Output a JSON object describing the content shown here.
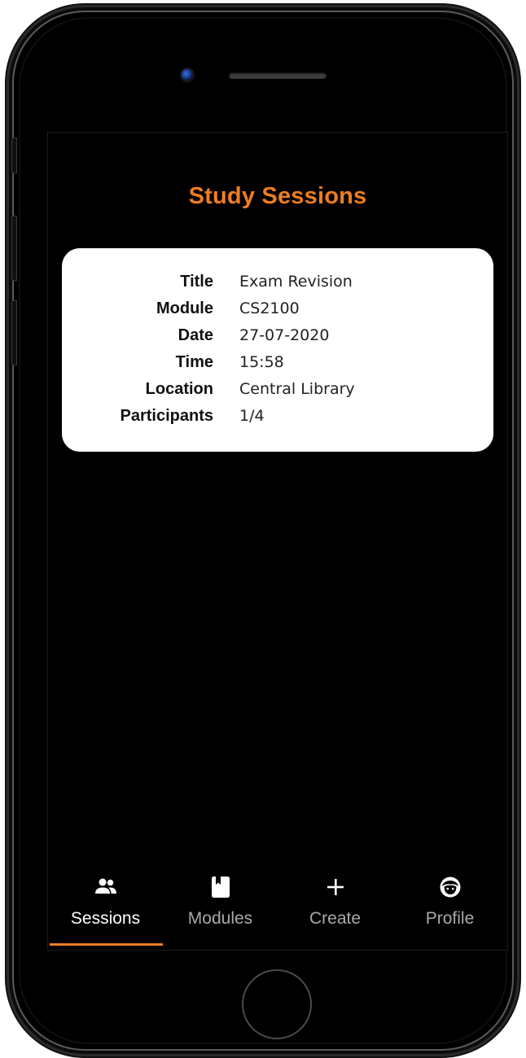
{
  "header": {
    "title": "Study Sessions"
  },
  "session": {
    "fields": [
      {
        "label": "Title",
        "value": "Exam Revision"
      },
      {
        "label": "Module",
        "value": "CS2100"
      },
      {
        "label": "Date",
        "value": "27-07-2020"
      },
      {
        "label": "Time",
        "value": "15:58"
      },
      {
        "label": "Location",
        "value": "Central Library"
      },
      {
        "label": "Participants",
        "value": "1/4"
      }
    ]
  },
  "tabs": [
    {
      "label": "Sessions",
      "icon": "people-icon",
      "active": true
    },
    {
      "label": "Modules",
      "icon": "book-icon",
      "active": false
    },
    {
      "label": "Create",
      "icon": "plus-icon",
      "active": false
    },
    {
      "label": "Profile",
      "icon": "face-icon",
      "active": false
    }
  ],
  "colors": {
    "accent": "#ee7d22",
    "background": "#000000",
    "card": "#ffffff",
    "tab_inactive": "#a9a9a9"
  }
}
